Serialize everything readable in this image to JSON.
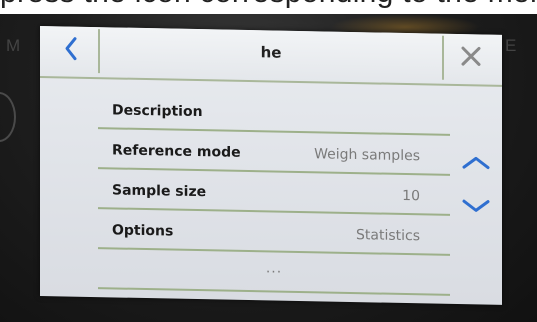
{
  "backdrop": {
    "top_text": "press the icon corresponding to the menu that you want to access in the page"
  },
  "header": {
    "title": "he",
    "back_icon": "chevron-left-icon",
    "close_icon": "close-icon"
  },
  "menu": {
    "items": [
      {
        "label": "Description",
        "value": ""
      },
      {
        "label": "Reference mode",
        "value": "Weigh samples"
      },
      {
        "label": "Sample size",
        "value": "10"
      },
      {
        "label": "Options",
        "value": "Statistics"
      }
    ],
    "more_label": "..."
  },
  "scroll": {
    "up_icon": "chevron-up-icon",
    "down_icon": "chevron-down-icon"
  },
  "colors": {
    "accent_blue": "#2f6fd0",
    "close_gray": "#8a8a8a",
    "separator_green": "#9db08a"
  }
}
